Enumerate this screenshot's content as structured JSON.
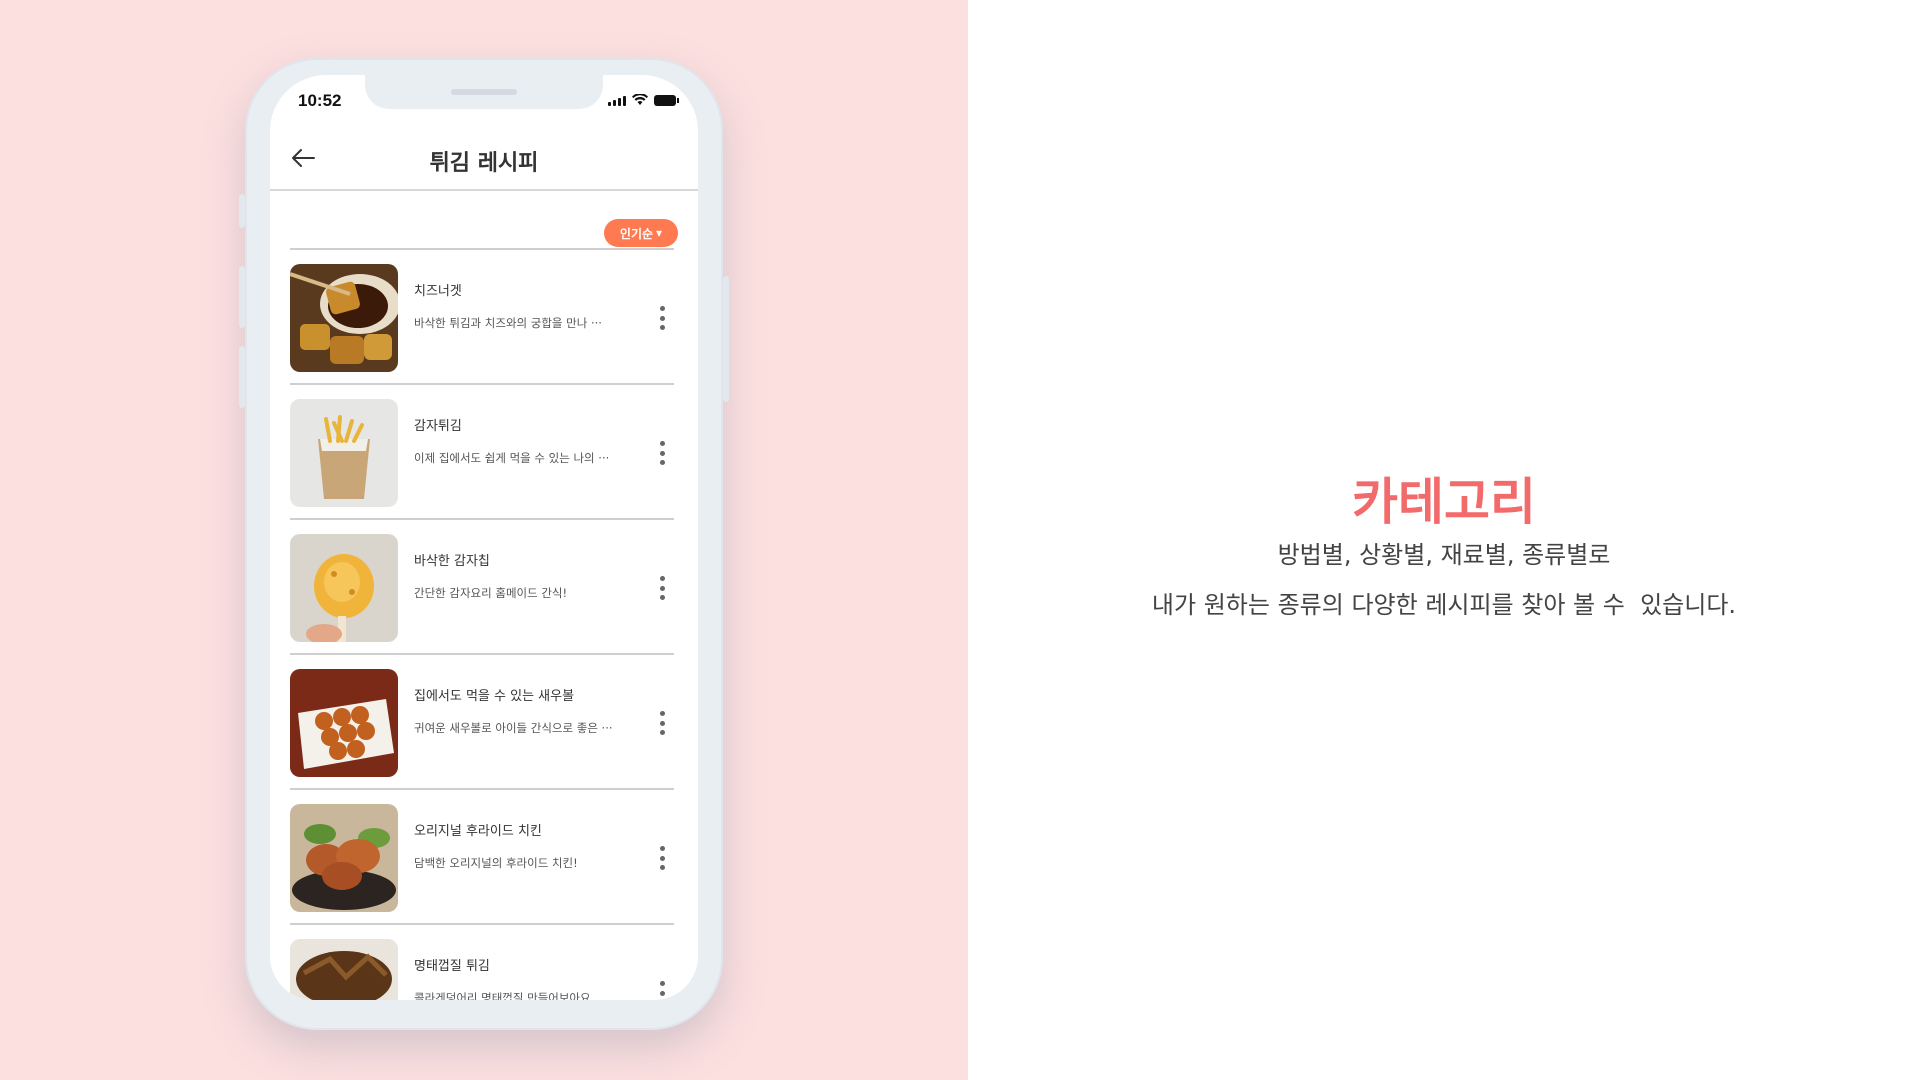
{
  "status_bar": {
    "time": "10:52"
  },
  "header": {
    "title": "튀김 레시피",
    "back_icon": "arrow-left-icon"
  },
  "sort": {
    "label": "인기순",
    "icon": "caret-down-icon"
  },
  "recipes": [
    {
      "title": "치즈너겟",
      "description": "바삭한 튀김과 치즈와의 궁합을 만나 ···"
    },
    {
      "title": "감자튀김",
      "description": "이제 집에서도 쉽게 먹을 수 있는 나의 ···"
    },
    {
      "title": "바삭한 감자칩",
      "description": "간단한 감자요리 홈메이드 간식!"
    },
    {
      "title": "집에서도 먹을 수 있는 새우볼",
      "description": "귀여운 새우볼로 아이들 간식으로 좋은 ···"
    },
    {
      "title": "오리지널 후라이드 치킨",
      "description": "담백한 오리지널의 후라이드 치킨!"
    },
    {
      "title": "명태껍질 튀김",
      "description": "콜라겐덩어리 명태껍질 만들어보아요"
    }
  ],
  "category": {
    "title": "카테고리",
    "line1": "방법별, 상황별, 재료별, 종류별로",
    "line2": "내가 원하는 종류의 다양한 레시피를 찾아 볼 수  있습니다."
  },
  "colors": {
    "accent": "#ff7a50",
    "category_title": "#f26a6a",
    "background_left": "#fcdfdf"
  }
}
